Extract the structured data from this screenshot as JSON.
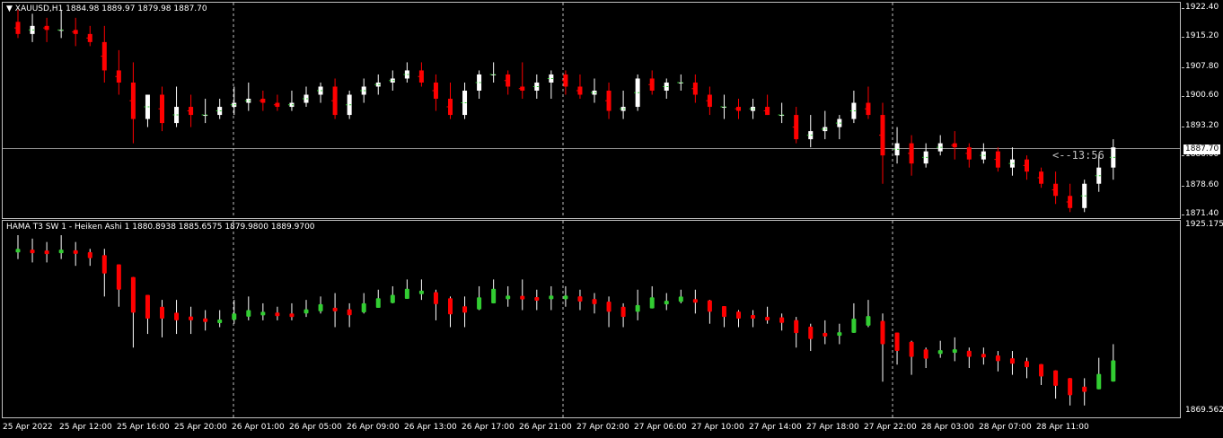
{
  "main_header": {
    "menu_arrow": "down-triangle-icon",
    "text": "XAUUSD,H1  1884.98 1889.97 1879.98 1887.70"
  },
  "main_scale": [
    "1922.40",
    "1915.20",
    "1907.80",
    "1900.60",
    "1893.20",
    "1886.00",
    "1878.60",
    "1871.40"
  ],
  "current_price": "1887.70",
  "countdown": "<--13:56",
  "indicator_header": "HAMA T3 SW 1 -  Heiken Ashi 1 1880.8938 1885.6575 1879.9800 1889.9700",
  "indicator_scale": [
    "1925.1757",
    "1869.5621"
  ],
  "time_axis": [
    "25 Apr 2022",
    "25 Apr 12:00",
    "25 Apr 16:00",
    "25 Apr 20:00",
    "26 Apr 01:00",
    "26 Apr 05:00",
    "26 Apr 09:00",
    "26 Apr 13:00",
    "26 Apr 17:00",
    "26 Apr 21:00",
    "27 Apr 02:00",
    "27 Apr 06:00",
    "27 Apr 10:00",
    "27 Apr 14:00",
    "27 Apr 18:00",
    "27 Apr 22:00",
    "28 Apr 03:00",
    "28 Apr 07:00",
    "28 Apr 11:00"
  ],
  "colors": {
    "bull": "#ffffff",
    "bear": "#ff0000",
    "ha_bull": "#32cd32",
    "ha_bear": "#ff0000",
    "grid": "#c0c0c0",
    "background": "#000000"
  },
  "chart_data": {
    "type": "candlestick",
    "symbol": "XAUUSD",
    "timeframe": "H1",
    "ylim": [
      1871.4,
      1922.4
    ],
    "series": [
      {
        "name": "XAUUSD,H1",
        "values": [
          [
            1919,
            1922,
            1915,
            1916
          ],
          [
            1916,
            1921,
            1914,
            1918
          ],
          [
            1918,
            1920,
            1914,
            1917
          ],
          [
            1917,
            1922,
            1915,
            1917
          ],
          [
            1917,
            1920,
            1913,
            1916
          ],
          [
            1916,
            1918,
            1913,
            1914
          ],
          [
            1914,
            1918,
            1904,
            1907
          ],
          [
            1907,
            1912,
            1901,
            1904
          ],
          [
            1904,
            1909,
            1889,
            1895
          ],
          [
            1895,
            1901,
            1893,
            1901
          ],
          [
            1901,
            1903,
            1892,
            1894
          ],
          [
            1894,
            1903,
            1893,
            1898
          ],
          [
            1898,
            1901,
            1893,
            1896
          ],
          [
            1896,
            1900,
            1894,
            1896
          ],
          [
            1896,
            1900,
            1895,
            1898
          ],
          [
            1898,
            1903,
            1896,
            1899
          ],
          [
            1899,
            1904,
            1897,
            1900
          ],
          [
            1900,
            1902,
            1897,
            1899
          ],
          [
            1899,
            1901,
            1897,
            1898
          ],
          [
            1898,
            1902,
            1897,
            1899
          ],
          [
            1899,
            1903,
            1898,
            1901
          ],
          [
            1901,
            1904,
            1899,
            1903
          ],
          [
            1903,
            1905,
            1895,
            1896
          ],
          [
            1896,
            1902,
            1895,
            1901
          ],
          [
            1901,
            1905,
            1899,
            1903
          ],
          [
            1903,
            1906,
            1901,
            1904
          ],
          [
            1904,
            1907,
            1902,
            1905
          ],
          [
            1905,
            1909,
            1904,
            1907
          ],
          [
            1907,
            1909,
            1903,
            1904
          ],
          [
            1904,
            1906,
            1897,
            1900
          ],
          [
            1900,
            1904,
            1895,
            1896
          ],
          [
            1896,
            1904,
            1895,
            1902
          ],
          [
            1902,
            1907,
            1900,
            1906
          ],
          [
            1906,
            1909,
            1904,
            1906
          ],
          [
            1906,
            1907,
            1901,
            1903
          ],
          [
            1903,
            1909,
            1900,
            1902
          ],
          [
            1902,
            1906,
            1900,
            1904
          ],
          [
            1904,
            1907,
            1900,
            1906
          ],
          [
            1906,
            1907,
            1901,
            1903
          ],
          [
            1903,
            1906,
            1900,
            1901
          ],
          [
            1901,
            1905,
            1899,
            1902
          ],
          [
            1902,
            1904,
            1895,
            1897
          ],
          [
            1897,
            1902,
            1895,
            1898
          ],
          [
            1898,
            1906,
            1897,
            1905
          ],
          [
            1905,
            1907,
            1901,
            1902
          ],
          [
            1902,
            1905,
            1900,
            1904
          ],
          [
            1904,
            1906,
            1902,
            1904
          ],
          [
            1904,
            1906,
            1899,
            1901
          ],
          [
            1901,
            1903,
            1896,
            1898
          ],
          [
            1898,
            1901,
            1895,
            1898
          ],
          [
            1898,
            1900,
            1895,
            1897
          ],
          [
            1897,
            1900,
            1895,
            1898
          ],
          [
            1898,
            1901,
            1896,
            1896
          ],
          [
            1896,
            1899,
            1894,
            1896
          ],
          [
            1896,
            1898,
            1889,
            1890
          ],
          [
            1890,
            1896,
            1888,
            1892
          ],
          [
            1892,
            1897,
            1890,
            1893
          ],
          [
            1893,
            1896,
            1890,
            1895
          ],
          [
            1895,
            1902,
            1894,
            1899
          ],
          [
            1899,
            1903,
            1895,
            1896
          ],
          [
            1896,
            1899,
            1879,
            1886
          ],
          [
            1886,
            1893,
            1884,
            1889
          ],
          [
            1889,
            1891,
            1881,
            1884
          ],
          [
            1884,
            1889,
            1883,
            1887
          ],
          [
            1887,
            1891,
            1886,
            1889
          ],
          [
            1889,
            1892,
            1885,
            1888
          ],
          [
            1888,
            1889,
            1883,
            1885
          ],
          [
            1885,
            1889,
            1884,
            1887
          ],
          [
            1887,
            1888,
            1882,
            1883
          ],
          [
            1883,
            1888,
            1881,
            1885
          ],
          [
            1885,
            1886,
            1880,
            1882
          ],
          [
            1882,
            1883,
            1878,
            1879
          ],
          [
            1879,
            1882,
            1874,
            1876
          ],
          [
            1876,
            1879,
            1872,
            1873
          ],
          [
            1873,
            1880,
            1872,
            1879
          ],
          [
            1879,
            1886,
            1877,
            1883
          ],
          [
            1883,
            1890,
            1880,
            1888
          ]
        ]
      }
    ]
  },
  "indicator_data": {
    "name": "HAMA T3 SW 1 -  Heiken Ashi 1",
    "ylim": [
      1869.5621,
      1925.1757
    ]
  }
}
